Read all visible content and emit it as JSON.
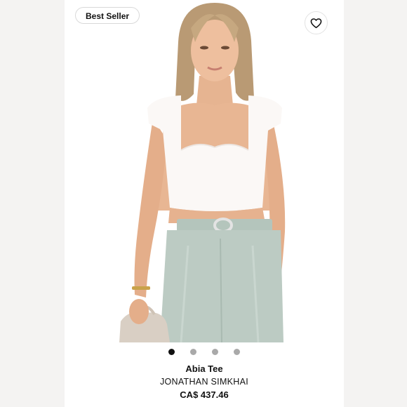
{
  "badge": {
    "label": "Best Seller"
  },
  "favorite": {
    "icon": "heart-icon"
  },
  "carousel": {
    "total": 4,
    "active_index": 0
  },
  "product": {
    "name": "Abia Tee",
    "brand": "JONATHAN SIMKHAI",
    "price": "CA$ 437.46"
  },
  "colors": {
    "top": "#fbf8f6",
    "pants": "#bcccc3",
    "hair": "#b99a74",
    "skin": "#e9b895",
    "active_dot": "#111111",
    "inactive_dot": "#a9a9a9"
  }
}
